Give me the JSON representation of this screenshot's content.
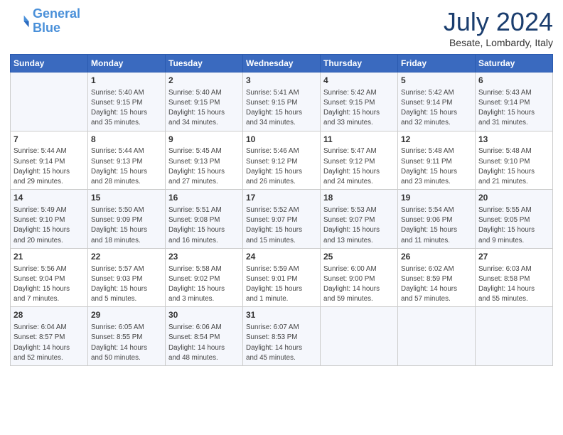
{
  "header": {
    "logo_line1": "General",
    "logo_line2": "Blue",
    "month_title": "July 2024",
    "location": "Besate, Lombardy, Italy"
  },
  "days_of_week": [
    "Sunday",
    "Monday",
    "Tuesday",
    "Wednesday",
    "Thursday",
    "Friday",
    "Saturday"
  ],
  "weeks": [
    [
      {
        "day": "",
        "info": ""
      },
      {
        "day": "1",
        "info": "Sunrise: 5:40 AM\nSunset: 9:15 PM\nDaylight: 15 hours\nand 35 minutes."
      },
      {
        "day": "2",
        "info": "Sunrise: 5:40 AM\nSunset: 9:15 PM\nDaylight: 15 hours\nand 34 minutes."
      },
      {
        "day": "3",
        "info": "Sunrise: 5:41 AM\nSunset: 9:15 PM\nDaylight: 15 hours\nand 34 minutes."
      },
      {
        "day": "4",
        "info": "Sunrise: 5:42 AM\nSunset: 9:15 PM\nDaylight: 15 hours\nand 33 minutes."
      },
      {
        "day": "5",
        "info": "Sunrise: 5:42 AM\nSunset: 9:14 PM\nDaylight: 15 hours\nand 32 minutes."
      },
      {
        "day": "6",
        "info": "Sunrise: 5:43 AM\nSunset: 9:14 PM\nDaylight: 15 hours\nand 31 minutes."
      }
    ],
    [
      {
        "day": "7",
        "info": "Sunrise: 5:44 AM\nSunset: 9:14 PM\nDaylight: 15 hours\nand 29 minutes."
      },
      {
        "day": "8",
        "info": "Sunrise: 5:44 AM\nSunset: 9:13 PM\nDaylight: 15 hours\nand 28 minutes."
      },
      {
        "day": "9",
        "info": "Sunrise: 5:45 AM\nSunset: 9:13 PM\nDaylight: 15 hours\nand 27 minutes."
      },
      {
        "day": "10",
        "info": "Sunrise: 5:46 AM\nSunset: 9:12 PM\nDaylight: 15 hours\nand 26 minutes."
      },
      {
        "day": "11",
        "info": "Sunrise: 5:47 AM\nSunset: 9:12 PM\nDaylight: 15 hours\nand 24 minutes."
      },
      {
        "day": "12",
        "info": "Sunrise: 5:48 AM\nSunset: 9:11 PM\nDaylight: 15 hours\nand 23 minutes."
      },
      {
        "day": "13",
        "info": "Sunrise: 5:48 AM\nSunset: 9:10 PM\nDaylight: 15 hours\nand 21 minutes."
      }
    ],
    [
      {
        "day": "14",
        "info": "Sunrise: 5:49 AM\nSunset: 9:10 PM\nDaylight: 15 hours\nand 20 minutes."
      },
      {
        "day": "15",
        "info": "Sunrise: 5:50 AM\nSunset: 9:09 PM\nDaylight: 15 hours\nand 18 minutes."
      },
      {
        "day": "16",
        "info": "Sunrise: 5:51 AM\nSunset: 9:08 PM\nDaylight: 15 hours\nand 16 minutes."
      },
      {
        "day": "17",
        "info": "Sunrise: 5:52 AM\nSunset: 9:07 PM\nDaylight: 15 hours\nand 15 minutes."
      },
      {
        "day": "18",
        "info": "Sunrise: 5:53 AM\nSunset: 9:07 PM\nDaylight: 15 hours\nand 13 minutes."
      },
      {
        "day": "19",
        "info": "Sunrise: 5:54 AM\nSunset: 9:06 PM\nDaylight: 15 hours\nand 11 minutes."
      },
      {
        "day": "20",
        "info": "Sunrise: 5:55 AM\nSunset: 9:05 PM\nDaylight: 15 hours\nand 9 minutes."
      }
    ],
    [
      {
        "day": "21",
        "info": "Sunrise: 5:56 AM\nSunset: 9:04 PM\nDaylight: 15 hours\nand 7 minutes."
      },
      {
        "day": "22",
        "info": "Sunrise: 5:57 AM\nSunset: 9:03 PM\nDaylight: 15 hours\nand 5 minutes."
      },
      {
        "day": "23",
        "info": "Sunrise: 5:58 AM\nSunset: 9:02 PM\nDaylight: 15 hours\nand 3 minutes."
      },
      {
        "day": "24",
        "info": "Sunrise: 5:59 AM\nSunset: 9:01 PM\nDaylight: 15 hours\nand 1 minute."
      },
      {
        "day": "25",
        "info": "Sunrise: 6:00 AM\nSunset: 9:00 PM\nDaylight: 14 hours\nand 59 minutes."
      },
      {
        "day": "26",
        "info": "Sunrise: 6:02 AM\nSunset: 8:59 PM\nDaylight: 14 hours\nand 57 minutes."
      },
      {
        "day": "27",
        "info": "Sunrise: 6:03 AM\nSunset: 8:58 PM\nDaylight: 14 hours\nand 55 minutes."
      }
    ],
    [
      {
        "day": "28",
        "info": "Sunrise: 6:04 AM\nSunset: 8:57 PM\nDaylight: 14 hours\nand 52 minutes."
      },
      {
        "day": "29",
        "info": "Sunrise: 6:05 AM\nSunset: 8:55 PM\nDaylight: 14 hours\nand 50 minutes."
      },
      {
        "day": "30",
        "info": "Sunrise: 6:06 AM\nSunset: 8:54 PM\nDaylight: 14 hours\nand 48 minutes."
      },
      {
        "day": "31",
        "info": "Sunrise: 6:07 AM\nSunset: 8:53 PM\nDaylight: 14 hours\nand 45 minutes."
      },
      {
        "day": "",
        "info": ""
      },
      {
        "day": "",
        "info": ""
      },
      {
        "day": "",
        "info": ""
      }
    ]
  ]
}
